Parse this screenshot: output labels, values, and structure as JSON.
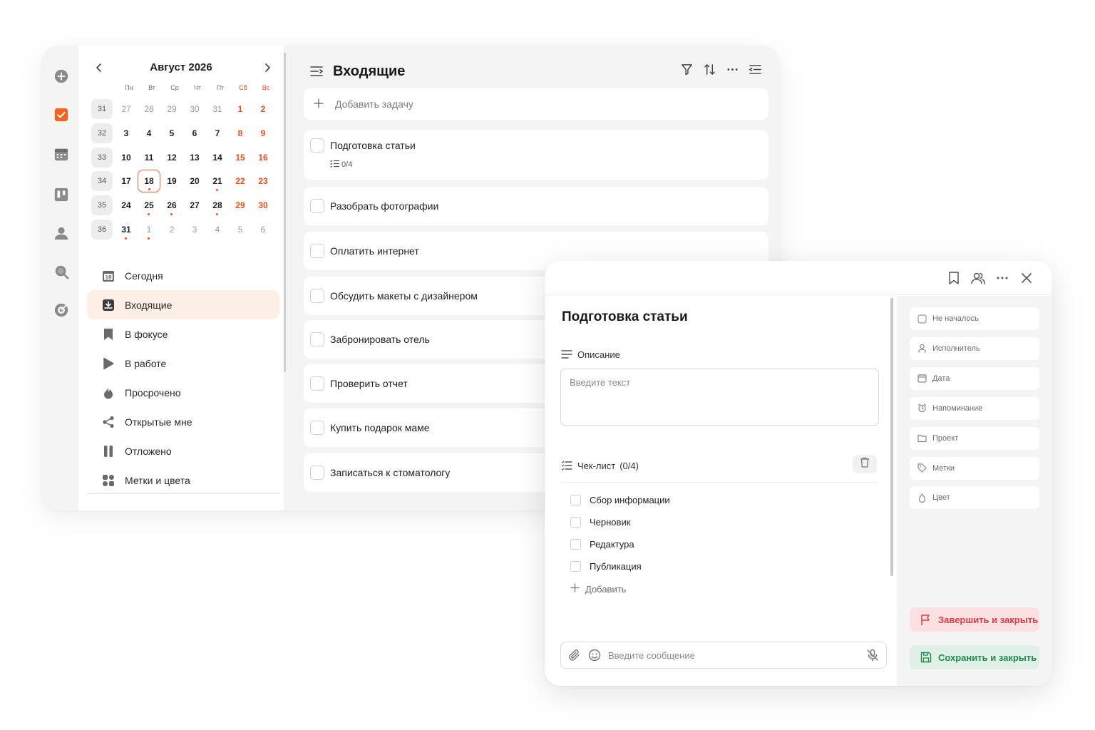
{
  "colors": {
    "accent": "#e84f1c",
    "active_bg": "#fdeee6",
    "danger": "#e23a47",
    "success": "#22894f"
  },
  "rail": {
    "icons": [
      "plus-circle-icon",
      "checkbox-icon",
      "calendar-grid-icon",
      "kanban-icon",
      "user-icon",
      "search-icon",
      "target-icon"
    ]
  },
  "calendar": {
    "title": "Август 2026",
    "weekdays": [
      "Пн",
      "Вт",
      "Ср",
      "Чт",
      "Пт",
      "Сб",
      "Вс"
    ],
    "weeks": [
      {
        "num": "31",
        "days": [
          {
            "d": "27",
            "kind": "muted"
          },
          {
            "d": "28",
            "kind": "muted"
          },
          {
            "d": "29",
            "kind": "muted"
          },
          {
            "d": "30",
            "kind": "muted"
          },
          {
            "d": "31",
            "kind": "muted"
          },
          {
            "d": "1",
            "kind": "wknd"
          },
          {
            "d": "2",
            "kind": "wknd"
          }
        ]
      },
      {
        "num": "32",
        "days": [
          {
            "d": "3"
          },
          {
            "d": "4"
          },
          {
            "d": "5"
          },
          {
            "d": "6"
          },
          {
            "d": "7"
          },
          {
            "d": "8",
            "kind": "wknd"
          },
          {
            "d": "9",
            "kind": "wknd"
          }
        ]
      },
      {
        "num": "33",
        "days": [
          {
            "d": "10"
          },
          {
            "d": "11"
          },
          {
            "d": "12"
          },
          {
            "d": "13"
          },
          {
            "d": "14"
          },
          {
            "d": "15",
            "kind": "wknd"
          },
          {
            "d": "16",
            "kind": "wknd"
          }
        ]
      },
      {
        "num": "34",
        "days": [
          {
            "d": "17"
          },
          {
            "d": "18",
            "today": true,
            "dot": true
          },
          {
            "d": "19"
          },
          {
            "d": "20"
          },
          {
            "d": "21",
            "dot": true
          },
          {
            "d": "22",
            "kind": "wknd"
          },
          {
            "d": "23",
            "kind": "wknd"
          }
        ]
      },
      {
        "num": "35",
        "days": [
          {
            "d": "24"
          },
          {
            "d": "25",
            "dot": true
          },
          {
            "d": "26",
            "dot": true
          },
          {
            "d": "27"
          },
          {
            "d": "28",
            "dot": true
          },
          {
            "d": "29",
            "kind": "wknd"
          },
          {
            "d": "30",
            "kind": "wknd"
          }
        ]
      },
      {
        "num": "36",
        "days": [
          {
            "d": "31",
            "dot": true
          },
          {
            "d": "1",
            "kind": "muted",
            "dot": true
          },
          {
            "d": "2",
            "kind": "muted"
          },
          {
            "d": "3",
            "kind": "muted"
          },
          {
            "d": "4",
            "kind": "muted"
          },
          {
            "d": "5",
            "kind": "muted"
          },
          {
            "d": "6",
            "kind": "muted"
          }
        ]
      }
    ]
  },
  "nav": [
    {
      "label": "Сегодня",
      "icon": "calendar-today-icon",
      "active": false
    },
    {
      "label": "Входящие",
      "icon": "inbox-icon",
      "active": true
    },
    {
      "label": "В фокусе",
      "icon": "bookmark-icon",
      "active": false
    },
    {
      "label": "В работе",
      "icon": "play-icon",
      "active": false
    },
    {
      "label": "Просрочено",
      "icon": "flame-icon",
      "active": false
    },
    {
      "label": "Открытые мне",
      "icon": "share-icon",
      "active": false
    },
    {
      "label": "Отложено",
      "icon": "pause-icon",
      "active": false
    },
    {
      "label": "Метки и цвета",
      "icon": "tags-icon",
      "active": false
    }
  ],
  "list": {
    "title": "Входящие",
    "add_task": "Добавить задачу",
    "tasks": [
      {
        "label": "Подготовка статьи",
        "sub": "0/4"
      },
      {
        "label": "Разобрать фотографии"
      },
      {
        "label": "Оплатить интернет"
      },
      {
        "label": "Обсудить макеты с дизайнером"
      },
      {
        "label": "Забронировать отель"
      },
      {
        "label": "Проверить отчет"
      },
      {
        "label": "Купить подарок маме"
      },
      {
        "label": "Записаться к стоматологу"
      }
    ]
  },
  "detail": {
    "title": "Подготовка статьи",
    "description_label": "Описание",
    "description_placeholder": "Введите текст",
    "checklist_label": "Чек-лист",
    "checklist_count": "(0/4)",
    "checklist": [
      "Сбор информации",
      "Черновик",
      "Редактура",
      "Публикация"
    ],
    "add_item": "Добавить",
    "message_placeholder": "Введите сообщение",
    "properties": [
      {
        "label": "Не началось",
        "icon": "status-checkbox-icon"
      },
      {
        "label": "Исполнитель",
        "icon": "user-icon"
      },
      {
        "label": "Дата",
        "icon": "calendar-icon"
      },
      {
        "label": "Напоминание",
        "icon": "alarm-icon"
      },
      {
        "label": "Проект",
        "icon": "folder-icon"
      },
      {
        "label": "Метки",
        "icon": "tag-icon"
      },
      {
        "label": "Цвет",
        "icon": "drop-icon"
      }
    ],
    "finish_button": "Завершить и закрыть",
    "save_button": "Сохранить и закрыть"
  }
}
